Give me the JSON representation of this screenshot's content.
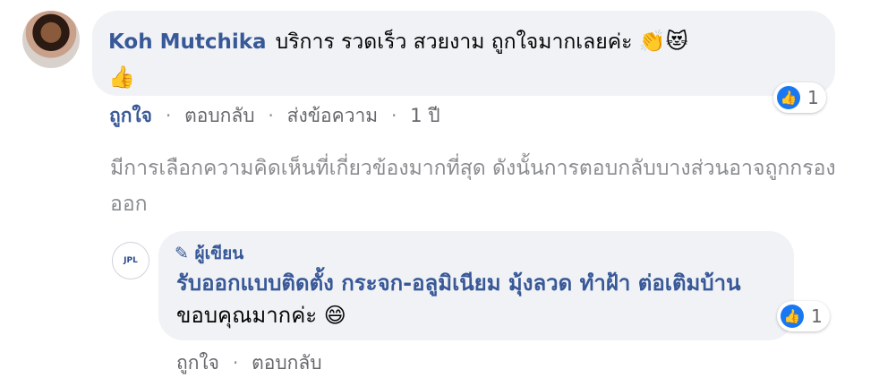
{
  "comment": {
    "author": "Koh Mutchika",
    "text": "บริการ รวดเร็ว สวยงาม ถูกใจมากเลยค่ะ",
    "emojis": [
      "👏",
      "😻",
      "👍"
    ],
    "reaction_count": "1",
    "actions": {
      "like": "ถูกใจ",
      "reply": "ตอบกลับ",
      "message": "ส่งข้อความ",
      "time": "1 ปี"
    }
  },
  "notice": "มีการเลือกความคิดเห็นที่เกี่ยวข้องมากที่สุด ดังนั้นการตอบกลับบางส่วนอาจถูกกรองออก",
  "reply": {
    "badge_label": "ผู้เขียน",
    "page_name": "รับออกแบบติดตั้ง กระจก-อลูมิเนียม มุ้งลวด ทำฝ้า ต่อเติมบ้าน",
    "text": "ขอบคุณมากค่ะ",
    "emoji": "😄",
    "avatar_text": "JPL",
    "reaction_count": "1",
    "actions": {
      "like": "ถูกใจ",
      "reply": "ตอบกลับ"
    }
  },
  "colors": {
    "accent": "#385898",
    "bubble": "#f0f2f5",
    "like_blue": "#1877f2",
    "muted": "#65676b"
  }
}
